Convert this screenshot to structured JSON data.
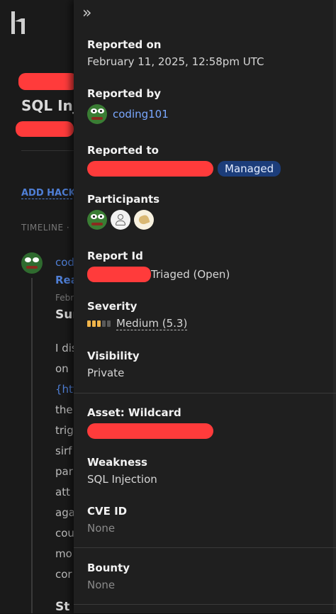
{
  "background": {
    "title_fragment": "SQL Inje",
    "add_hacker_fragment": "ADD HACK",
    "timeline_fragment": "TIMELINE ·",
    "comment_snippets": [
      "cod",
      "Rea",
      "Febr",
      "Sur",
      "I dis",
      "on",
      "{htt",
      "the",
      "trig",
      "sirf",
      "par",
      "att",
      "aga",
      "cou",
      "mo",
      "cor",
      "St"
    ]
  },
  "panel": {
    "collapse_icon": "double-chevron-right-icon",
    "reported_on": {
      "label": "Reported on",
      "value": "February 11, 2025, 12:58pm UTC"
    },
    "reported_by": {
      "label": "Reported by",
      "username": "coding101"
    },
    "reported_to": {
      "label": "Reported to",
      "badge": "Managed"
    },
    "participants": {
      "label": "Participants"
    },
    "report_id": {
      "label": "Report Id",
      "status": "Triaged (Open)"
    },
    "severity": {
      "label": "Severity",
      "value": "Medium (5.3)",
      "bar_filled": 3,
      "bar_total": 5
    },
    "visibility": {
      "label": "Visibility",
      "value": "Private"
    },
    "asset": {
      "label": "Asset: Wildcard"
    },
    "weakness": {
      "label": "Weakness",
      "value": "SQL Injection"
    },
    "cve": {
      "label": "CVE ID",
      "value": "None"
    },
    "bounty": {
      "label": "Bounty",
      "value": "None"
    }
  },
  "colors": {
    "redaction": "#ff3b3b",
    "link": "#7aa8ff",
    "managed_badge": "#1c3d7a",
    "severity_fill": "#f0b44a"
  }
}
